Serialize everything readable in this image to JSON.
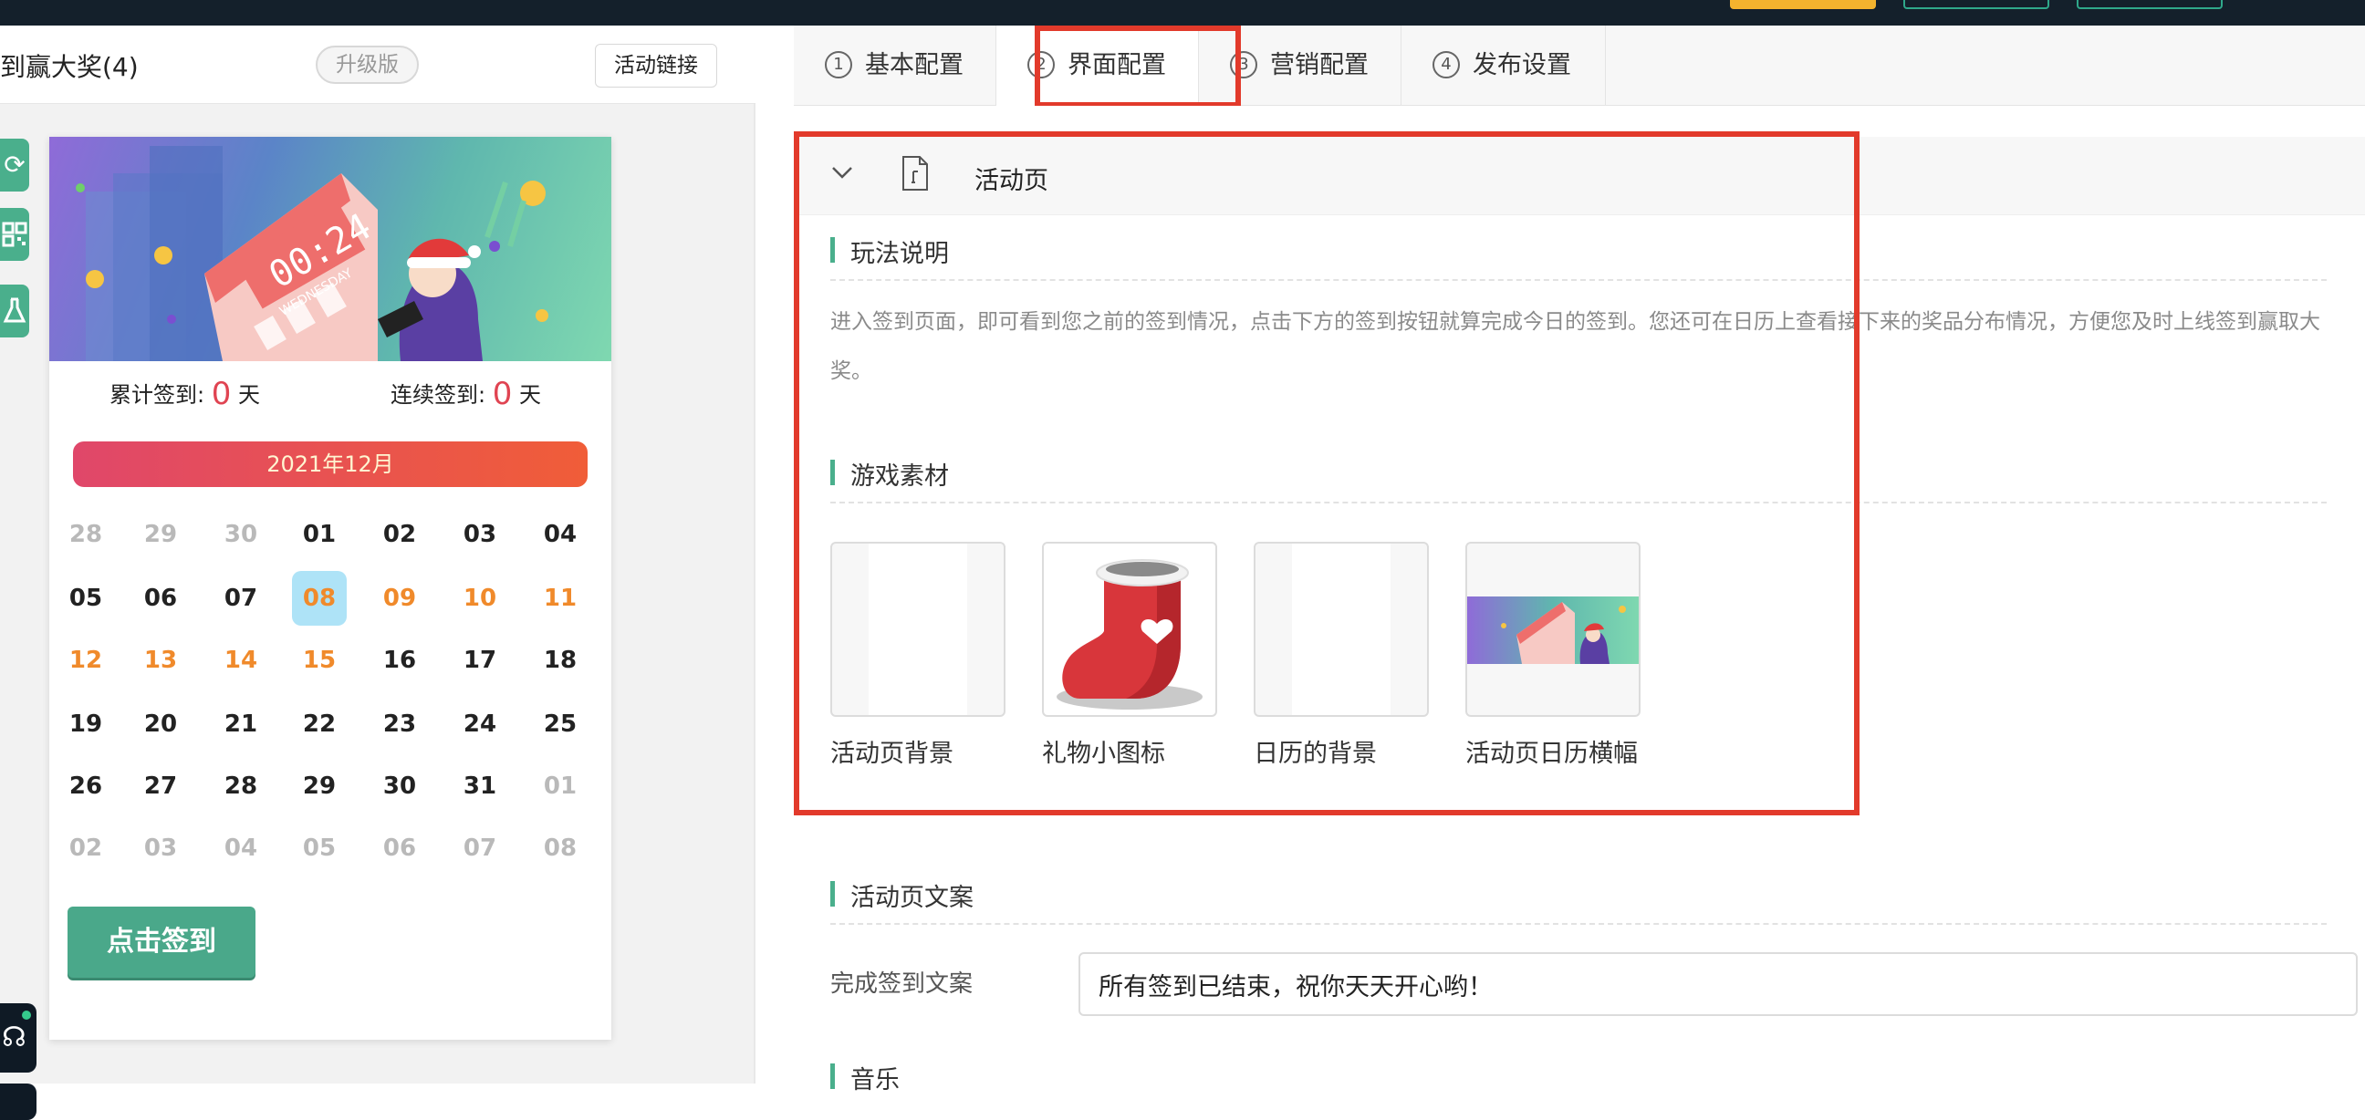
{
  "topbar": {},
  "left": {
    "app_title": "到赢大奖(4)",
    "version_badge": "升级版",
    "link_button": "活动链接",
    "tools": [
      "refresh-icon",
      "qrcode-icon",
      "flask-icon",
      "headset-icon"
    ]
  },
  "phone": {
    "banner": {
      "clock_text": "00:24",
      "weekday_text": "WEDNESDAY"
    },
    "stat_total_label": "累计签到:",
    "stat_total_value": "0",
    "stat_total_unit": "天",
    "stat_cont_label": "连续签到:",
    "stat_cont_value": "0",
    "stat_cont_unit": "天",
    "month": "2021年12月",
    "days": [
      [
        "28",
        "29",
        "30",
        "01",
        "02",
        "03",
        "04"
      ],
      [
        "05",
        "06",
        "07",
        "08",
        "09",
        "10",
        "11"
      ],
      [
        "12",
        "13",
        "14",
        "15",
        "16",
        "17",
        "18"
      ],
      [
        "19",
        "20",
        "21",
        "22",
        "23",
        "24",
        "25"
      ],
      [
        "26",
        "27",
        "28",
        "29",
        "30",
        "31",
        "01"
      ],
      [
        "02",
        "03",
        "04",
        "05",
        "06",
        "07",
        "08"
      ]
    ],
    "day_styles": [
      [
        "gray",
        "gray",
        "gray",
        "black",
        "black",
        "black",
        "black"
      ],
      [
        "black",
        "black",
        "black",
        "today",
        "orange",
        "orange",
        "orange"
      ],
      [
        "orange",
        "orange",
        "orange",
        "orange",
        "black",
        "black",
        "black"
      ],
      [
        "black",
        "black",
        "black",
        "black",
        "black",
        "black",
        "black"
      ],
      [
        "black",
        "black",
        "black",
        "black",
        "black",
        "black",
        "gray"
      ],
      [
        "gray",
        "gray",
        "gray",
        "gray",
        "gray",
        "gray",
        "gray"
      ]
    ],
    "signin_button": "点击签到"
  },
  "tabs": [
    {
      "num": "1",
      "label": "基本配置"
    },
    {
      "num": "2",
      "label": "界面配置"
    },
    {
      "num": "3",
      "label": "营销配置"
    },
    {
      "num": "4",
      "label": "发布设置"
    }
  ],
  "section": {
    "title": "活动页",
    "rules_title": "玩法说明",
    "rules_text": "进入签到页面，即可看到您之前的签到情况，点击下方的签到按钮就算完成今日的签到。您还可在日历上查看接下来的奖品分布情况，方便您及时上线签到赢取大奖。",
    "assets_title": "游戏素材",
    "assets": [
      {
        "label": "活动页背景"
      },
      {
        "label": "礼物小图标"
      },
      {
        "label": "日历的背景"
      },
      {
        "label": "活动页日历横幅"
      }
    ],
    "copy_title": "活动页文案",
    "copy_label": "完成签到文案",
    "copy_value": "所有签到已结束，祝你天天开心哟！",
    "music_title": "音乐"
  },
  "colors": {
    "accent": "#4aaf8c",
    "highlight": "#e23a2b",
    "orange": "#f08a2b",
    "red": "#e04452"
  }
}
